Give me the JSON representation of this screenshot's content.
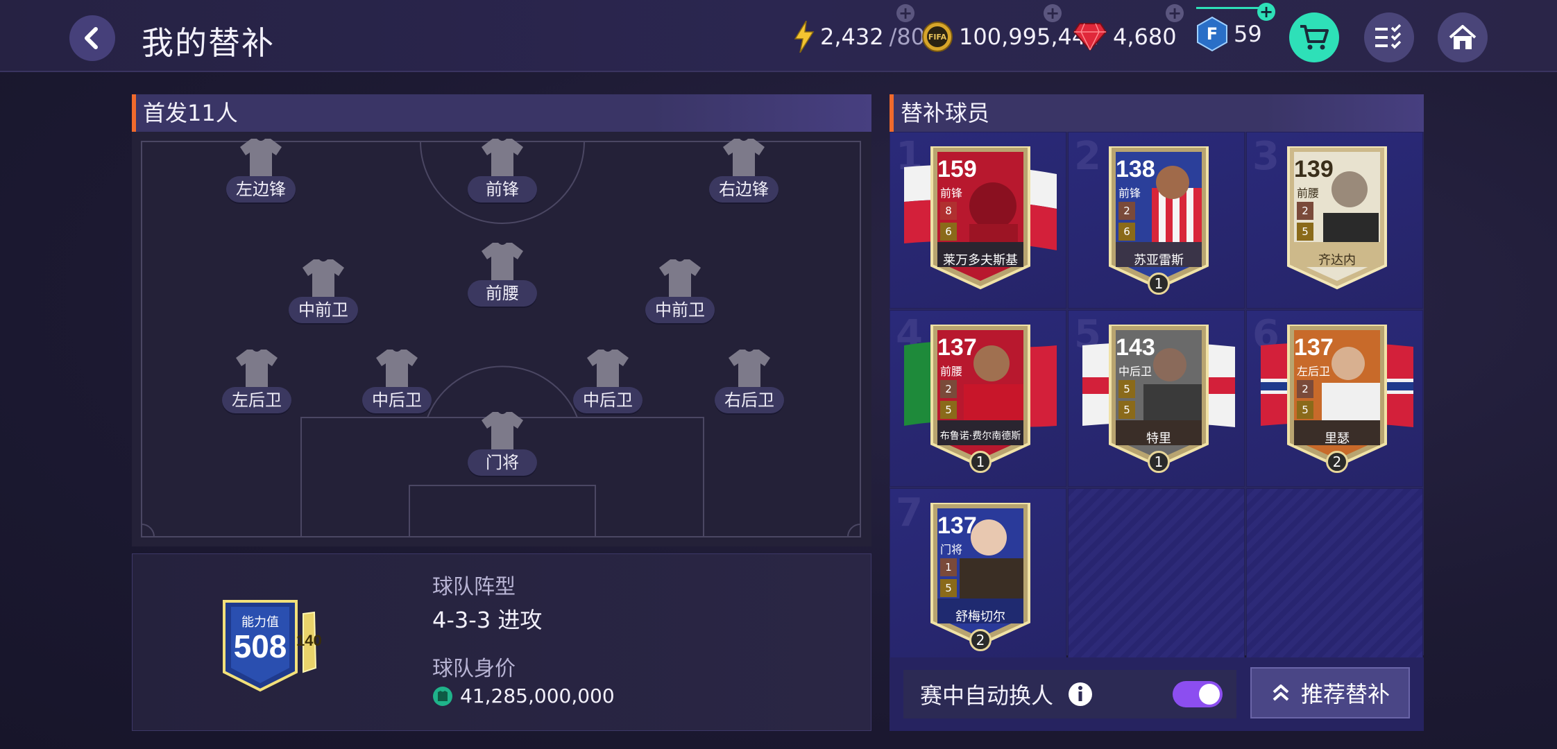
{
  "header": {
    "title": "我的替补",
    "energy": {
      "value": "2,432",
      "max": "/80"
    },
    "coins": "100,995,444",
    "gems": "4,680",
    "fifa_points": "59"
  },
  "lineup": {
    "title": "首发11人",
    "positions": {
      "lw": "左边锋",
      "st": "前锋",
      "rw": "右边锋",
      "lcm": "中前卫",
      "cam": "前腰",
      "rcm": "中前卫",
      "lb": "左后卫",
      "lcb": "中后卫",
      "rcb": "中后卫",
      "rb": "右后卫",
      "gk": "门将"
    }
  },
  "summary": {
    "ovr_label": "能力值",
    "ovr": "508",
    "ovr_small": "140",
    "formation_label": "球队阵型",
    "formation": "4-3-3 进攻",
    "value_label": "球队身价",
    "value": "41,285,000,000"
  },
  "subs": {
    "title": "替补球员",
    "players": [
      {
        "slot": "1",
        "rating": "159",
        "pos": "前锋",
        "name": "莱万多夫斯基",
        "lvl_a": "8",
        "lvl_b": "6"
      },
      {
        "slot": "2",
        "rating": "138",
        "pos": "前锋",
        "name": "苏亚雷斯",
        "lvl_a": "2",
        "lvl_b": "6",
        "rank": "1"
      },
      {
        "slot": "3",
        "rating": "139",
        "pos": "前腰",
        "name": "齐达内",
        "lvl_a": "2",
        "lvl_b": "5"
      },
      {
        "slot": "4",
        "rating": "137",
        "pos": "前腰",
        "name": "布鲁诺·费尔南德斯",
        "lvl_a": "2",
        "lvl_b": "5",
        "rank": "1"
      },
      {
        "slot": "5",
        "rating": "143",
        "pos": "中后卫",
        "name": "特里",
        "lvl_a": "5",
        "lvl_b": "5",
        "rank": "1"
      },
      {
        "slot": "6",
        "rating": "137",
        "pos": "左后卫",
        "name": "里瑟",
        "lvl_a": "2",
        "lvl_b": "5",
        "rank": "2"
      },
      {
        "slot": "7",
        "rating": "137",
        "pos": "门将",
        "name": "舒梅切尔",
        "lvl_a": "1",
        "lvl_b": "5",
        "rank": "2"
      }
    ]
  },
  "footer": {
    "auto_sub_label": "赛中自动换人",
    "recommend_label": "推荐替补"
  },
  "colors": {
    "accent": "#f06a2c",
    "toggle": "#8c4ef0",
    "cart": "#2ee0b8"
  }
}
